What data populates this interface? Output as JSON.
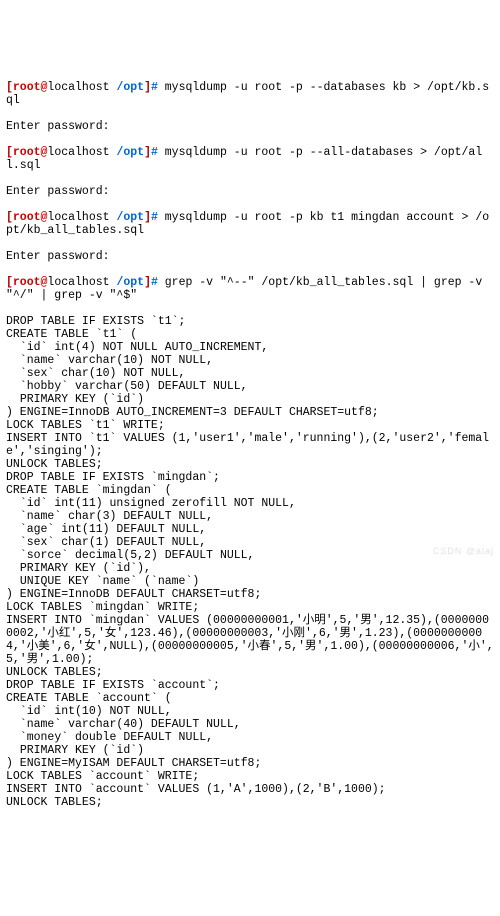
{
  "p1": {
    "br": "[",
    "u": "root",
    "at": "@",
    "h": "localhost",
    "sp": " ",
    "path": "/opt",
    "eb": "]",
    "hs": "#",
    "cmd": " mysqldump -u root -p --databases kb > /opt/kb.sql"
  },
  "l1": "Enter password:",
  "p2": {
    "br": "[",
    "u": "root",
    "at": "@",
    "h": "localhost",
    "sp": " ",
    "path": "/opt",
    "eb": "]",
    "hs": "#",
    "cmd": " mysqldump -u root -p --all-databases > /opt/all.sql"
  },
  "l2": "Enter password:",
  "p3": {
    "br": "[",
    "u": "root",
    "at": "@",
    "h": "localhost",
    "sp": " ",
    "path": "/opt",
    "eb": "]",
    "hs": "#",
    "cmd": " mysqldump -u root -p kb t1 mingdan account > /opt/kb_all_tables.sql"
  },
  "l3": "Enter password:",
  "p4": {
    "br": "[",
    "u": "root",
    "at": "@",
    "h": "localhost",
    "sp": " ",
    "path": "/opt",
    "eb": "]",
    "hs": "#",
    "cmd": " grep -v \"^--\" /opt/kb_all_tables.sql | grep -v \"^/\" | grep -v \"^$\""
  },
  "o": [
    "DROP TABLE IF EXISTS `t1`;",
    "CREATE TABLE `t1` (",
    "  `id` int(4) NOT NULL AUTO_INCREMENT,",
    "  `name` varchar(10) NOT NULL,",
    "  `sex` char(10) NOT NULL,",
    "  `hobby` varchar(50) DEFAULT NULL,",
    "  PRIMARY KEY (`id`)",
    ") ENGINE=InnoDB AUTO_INCREMENT=3 DEFAULT CHARSET=utf8;",
    "LOCK TABLES `t1` WRITE;",
    "INSERT INTO `t1` VALUES (1,'user1','male','running'),(2,'user2','female','singing');",
    "UNLOCK TABLES;",
    "DROP TABLE IF EXISTS `mingdan`;",
    "CREATE TABLE `mingdan` (",
    "  `id` int(11) unsigned zerofill NOT NULL,",
    "  `name` char(3) DEFAULT NULL,",
    "  `age` int(11) DEFAULT NULL,",
    "  `sex` char(1) DEFAULT NULL,",
    "  `sorce` decimal(5,2) DEFAULT NULL,",
    "  PRIMARY KEY (`id`),",
    "  UNIQUE KEY `name` (`name`)",
    ") ENGINE=InnoDB DEFAULT CHARSET=utf8;",
    "LOCK TABLES `mingdan` WRITE;",
    "INSERT INTO `mingdan` VALUES (00000000001,'小明',5,'男',12.35),(00000000002,'小红',5,'女',123.46),(00000000003,'小刚',6,'男',1.23),(00000000004,'小美',6,'女',NULL),(00000000005,'小春',5,'男',1.00),(00000000006,'小',5,'男',1.00);",
    "UNLOCK TABLES;",
    "DROP TABLE IF EXISTS `account`;",
    "CREATE TABLE `account` (",
    "  `id` int(10) NOT NULL,",
    "  `name` varchar(40) DEFAULT NULL,",
    "  `money` double DEFAULT NULL,",
    "  PRIMARY KEY (`id`)",
    ") ENGINE=MyISAM DEFAULT CHARSET=utf8;",
    "LOCK TABLES `account` WRITE;",
    "INSERT INTO `account` VALUES (1,'A',1000),(2,'B',1000);",
    "UNLOCK TABLES;"
  ],
  "watermark": "CSDN @alaj"
}
